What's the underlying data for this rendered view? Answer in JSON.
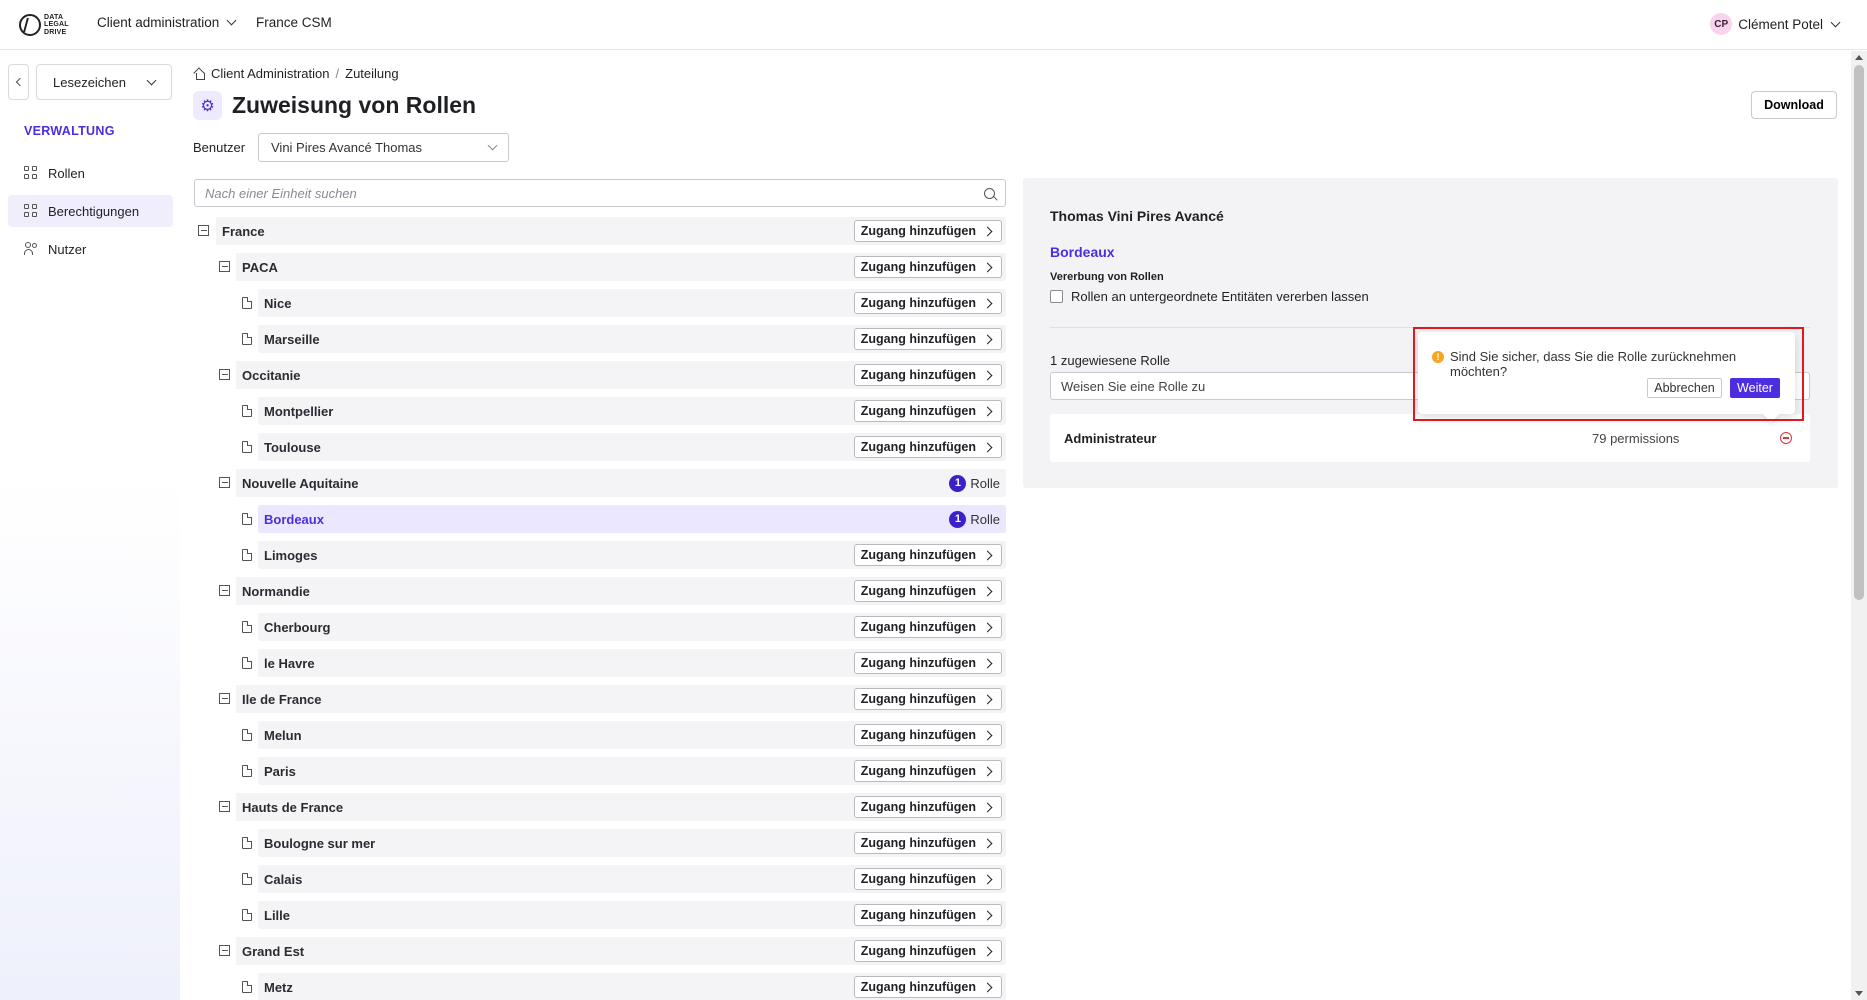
{
  "topbar": {
    "logo_text": [
      "DATA",
      "LEGAL",
      "DRIVE"
    ],
    "nav": [
      {
        "label": "Client administration",
        "has_dropdown": true
      },
      {
        "label": "France CSM",
        "has_dropdown": false
      }
    ],
    "user": {
      "initials": "CP",
      "name": "Clément Potel"
    }
  },
  "sidebar": {
    "bookmark_label": "Lesezeichen",
    "section": "VERWALTUNG",
    "items": [
      {
        "label": "Rollen",
        "icon": "grid-icon",
        "active": false
      },
      {
        "label": "Berechtigungen",
        "icon": "grid-icon",
        "active": true
      },
      {
        "label": "Nutzer",
        "icon": "users-icon",
        "active": false
      }
    ]
  },
  "header": {
    "breadcrumb": [
      "Client Administration",
      "/",
      "Zuteilung"
    ],
    "title": "Zuweisung von Rollen",
    "download_label": "Download",
    "user_filter_label": "Benutzer",
    "user_filter_value": "Vini Pires Avancé Thomas"
  },
  "search": {
    "placeholder": "Nach einer Einheit suchen"
  },
  "tree": {
    "add_label": "Zugang hinzufügen",
    "role_label": "Rolle",
    "rows": [
      {
        "name": "France",
        "level": 0,
        "type": "group",
        "roles": 0
      },
      {
        "name": "PACA",
        "level": 1,
        "type": "group",
        "roles": 0
      },
      {
        "name": "Nice",
        "level": 2,
        "type": "leaf",
        "roles": 0
      },
      {
        "name": "Marseille",
        "level": 2,
        "type": "leaf",
        "roles": 0
      },
      {
        "name": "Occitanie",
        "level": 1,
        "type": "group",
        "roles": 0
      },
      {
        "name": "Montpellier",
        "level": 2,
        "type": "leaf",
        "roles": 0
      },
      {
        "name": "Toulouse",
        "level": 2,
        "type": "leaf",
        "roles": 0
      },
      {
        "name": "Nouvelle Aquitaine",
        "level": 1,
        "type": "group",
        "roles": 1
      },
      {
        "name": "Bordeaux",
        "level": 2,
        "type": "leaf",
        "roles": 1,
        "selected": true
      },
      {
        "name": "Limoges",
        "level": 2,
        "type": "leaf",
        "roles": 0
      },
      {
        "name": "Normandie",
        "level": 1,
        "type": "group",
        "roles": 0
      },
      {
        "name": "Cherbourg",
        "level": 2,
        "type": "leaf",
        "roles": 0
      },
      {
        "name": "le Havre",
        "level": 2,
        "type": "leaf",
        "roles": 0
      },
      {
        "name": "Ile de France",
        "level": 1,
        "type": "group",
        "roles": 0
      },
      {
        "name": "Melun",
        "level": 2,
        "type": "leaf",
        "roles": 0
      },
      {
        "name": "Paris",
        "level": 2,
        "type": "leaf",
        "roles": 0
      },
      {
        "name": "Hauts de France",
        "level": 1,
        "type": "group",
        "roles": 0
      },
      {
        "name": "Boulogne sur mer",
        "level": 2,
        "type": "leaf",
        "roles": 0
      },
      {
        "name": "Calais",
        "level": 2,
        "type": "leaf",
        "roles": 0
      },
      {
        "name": "Lille",
        "level": 2,
        "type": "leaf",
        "roles": 0
      },
      {
        "name": "Grand Est",
        "level": 1,
        "type": "group",
        "roles": 0
      },
      {
        "name": "Metz",
        "level": 2,
        "type": "leaf",
        "roles": 0
      }
    ]
  },
  "panel": {
    "user_name": "Thomas Vini Pires Avancé",
    "entity": "Bordeaux",
    "inherit_title": "Vererbung von Rollen",
    "inherit_label": "Rollen an untergeordnete Entitäten vererben lassen",
    "assigned_count_label": "1 zugewiesene Rolle",
    "assign_placeholder": "Weisen Sie eine Rolle zu",
    "roles": [
      {
        "name": "Administrateur",
        "permissions": "79 permissions"
      }
    ]
  },
  "popconfirm": {
    "message": "Sind Sie sicher, dass Sie die Rolle zurücknehmen möchten?",
    "cancel_label": "Abbrechen",
    "ok_label": "Weiter",
    "warn_glyph": "!"
  },
  "colors": {
    "accent": "#4c2ee0",
    "badge": "#3a22c8",
    "danger": "#d9363e",
    "warning": "#f5a623",
    "highlight_border": "#e0181f"
  }
}
